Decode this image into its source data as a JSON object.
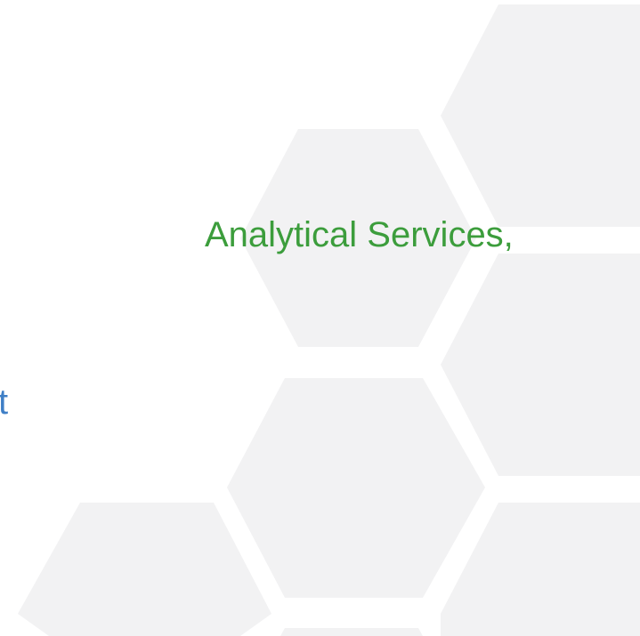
{
  "slide": {
    "subtitle_line": "Analytical Services,",
    "title_fragment": "t"
  },
  "colors": {
    "green_text": "#3c9d3c",
    "blue_text": "#3f7fc6",
    "hex_fill": "#f2f2f3",
    "background": "#ffffff"
  },
  "decor": {
    "pattern_icon": "hexagon-pattern"
  }
}
